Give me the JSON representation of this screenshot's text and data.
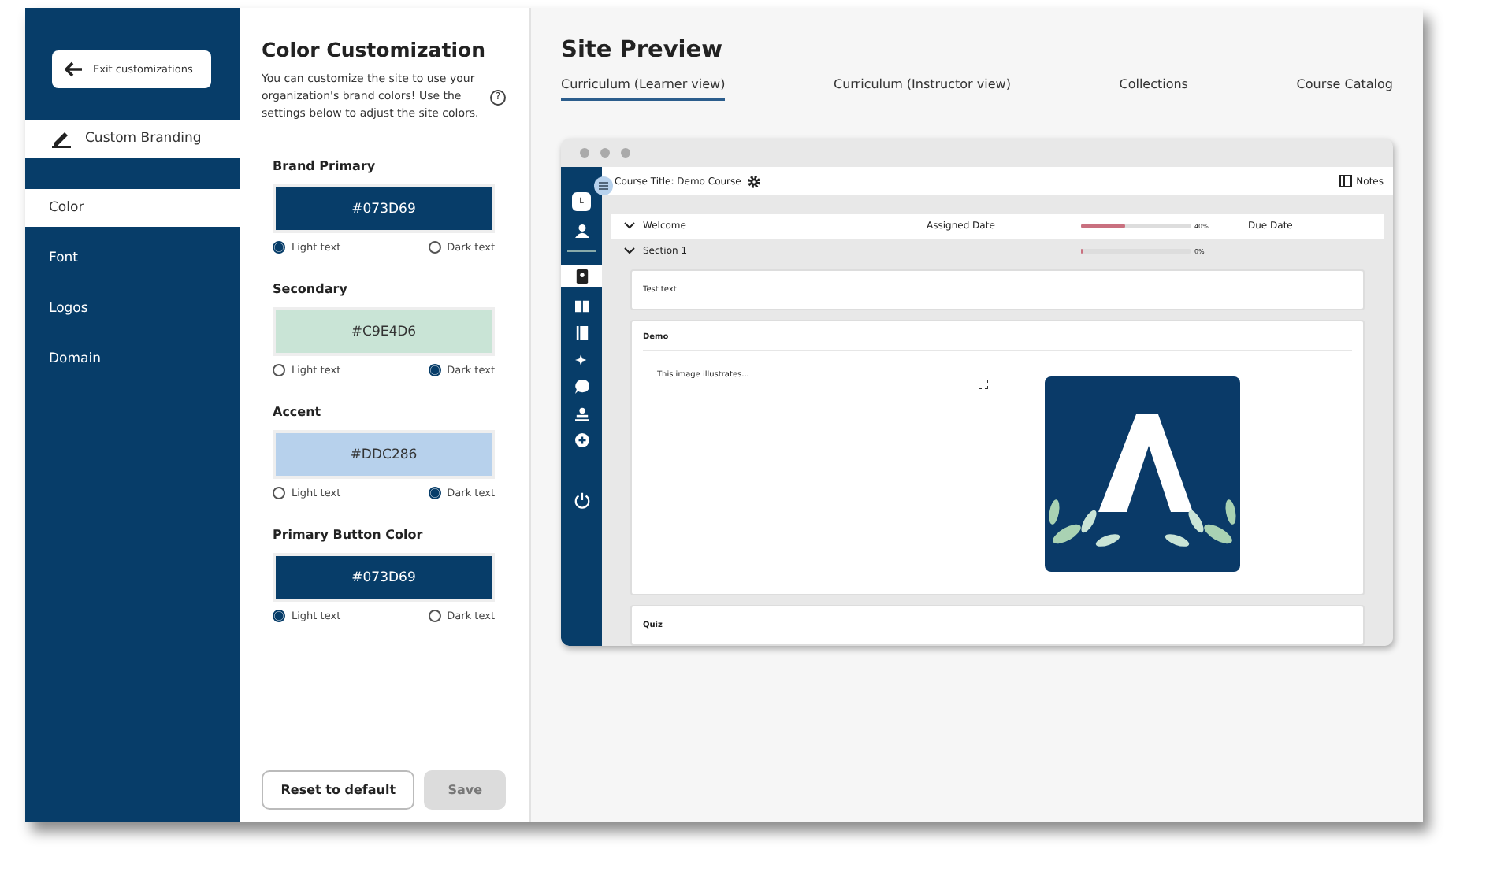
{
  "sidebar": {
    "exit_button": "Exit customizations",
    "section_title": "Custom Branding",
    "items": [
      {
        "label": "Color",
        "selected": true
      },
      {
        "label": "Font",
        "selected": false
      },
      {
        "label": "Logos",
        "selected": false
      },
      {
        "label": "Domain",
        "selected": false
      }
    ]
  },
  "panel": {
    "title": "Color Customization",
    "description": "You can customize the site to use your organization's brand colors! Use the settings below to adjust the site colors.",
    "help": "?",
    "colors": [
      {
        "label": "Brand Primary",
        "value": "#073D69",
        "color": "#073d69",
        "options": [
          {
            "label": "Light text",
            "selected": true
          },
          {
            "label": "Dark text",
            "selected": false
          }
        ]
      },
      {
        "label": "Secondary",
        "value": "#C9E4D6",
        "color": "#c9e4d6",
        "options": [
          {
            "label": "Light text",
            "selected": false
          },
          {
            "label": "Dark text",
            "selected": true
          }
        ]
      },
      {
        "label": "Accent",
        "value": "#DDC286",
        "color": "#b7d1ec",
        "options": [
          {
            "label": "Light text",
            "selected": false
          },
          {
            "label": "Dark text",
            "selected": true
          }
        ]
      },
      {
        "label": "Primary Button Color",
        "value": "#073D69",
        "color": "#073d69",
        "options": [
          {
            "label": "Light text",
            "selected": true
          },
          {
            "label": "Dark text",
            "selected": false
          }
        ]
      }
    ],
    "reset_button": "Reset to default",
    "save_button": {
      "label": "Save",
      "disabled": true
    }
  },
  "preview": {
    "title": "Site Preview",
    "tabs": [
      {
        "label": "Curriculum (Learner view)",
        "selected": true
      },
      {
        "label": "Curriculum (Instructor view)",
        "selected": false
      },
      {
        "label": "Collections",
        "selected": false
      },
      {
        "label": "Course Catalog",
        "selected": false
      }
    ],
    "browser": {
      "avatar": "L",
      "course_title": "Course Title: Demo Course",
      "notes": "Notes",
      "rows": [
        {
          "title": "Welcome",
          "assigned": "Assigned Date",
          "level": 0.4,
          "percent": "40%",
          "due": "Due Date"
        },
        {
          "title": "Section 1",
          "level": 0,
          "percent": "0%"
        }
      ],
      "cards": [
        {
          "kind": "text",
          "body": "Test text"
        },
        {
          "title": "Demo",
          "body": "This image illustrates..."
        },
        {
          "kind": "heading",
          "title": "Quiz"
        }
      ]
    }
  }
}
